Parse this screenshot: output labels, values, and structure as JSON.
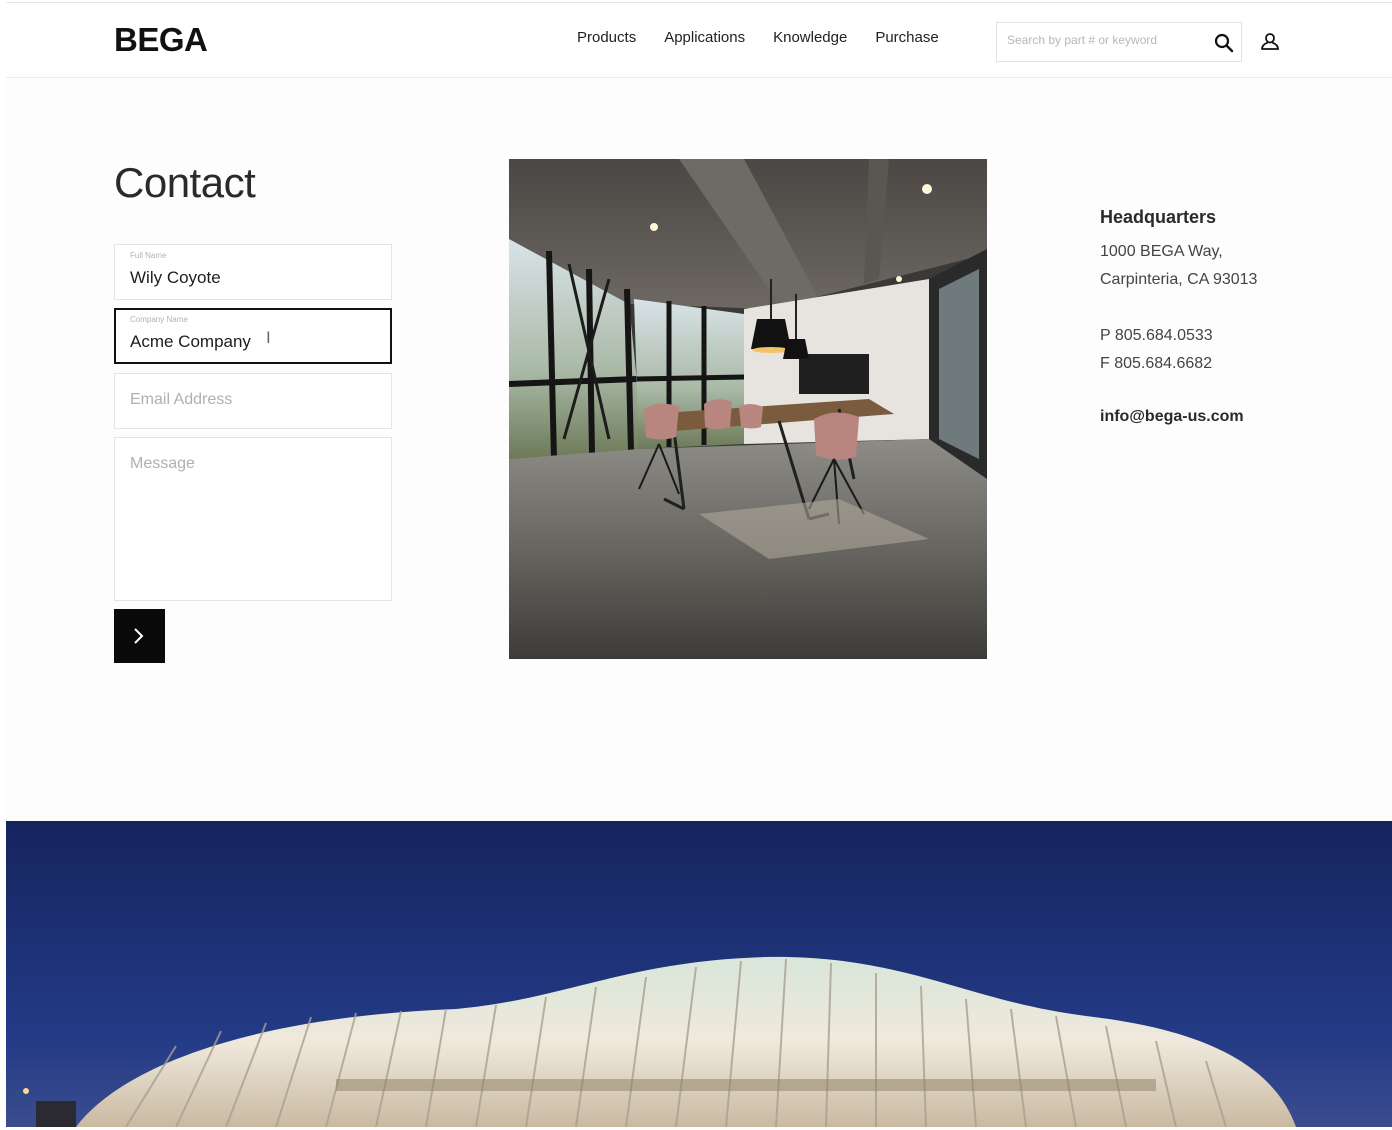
{
  "header": {
    "logo": "BEGA",
    "nav": [
      "Products",
      "Applications",
      "Knowledge",
      "Purchase"
    ],
    "search_placeholder": "Search by part # or keyword",
    "icons": [
      "search-icon",
      "account-icon"
    ]
  },
  "contact": {
    "title": "Contact",
    "full_name": {
      "label": "Full Name",
      "value": "Wily Coyote"
    },
    "company_name": {
      "label": "Company Name",
      "value": "Acme Company"
    },
    "email_placeholder": "Email Address",
    "message_placeholder": "Message",
    "submit_icon": "chevron-right-icon"
  },
  "headquarters": {
    "title": "Headquarters",
    "address_line1": "1000 BEGA Way,",
    "address_line2": "Carpinteria, CA 93013",
    "phone": "P 805.684.0533",
    "fax": "F 805.684.6682",
    "email": "info@bega-us.com"
  },
  "colors": {
    "accent": "#0a0a0a",
    "banner_sky": "#1d2f73"
  }
}
